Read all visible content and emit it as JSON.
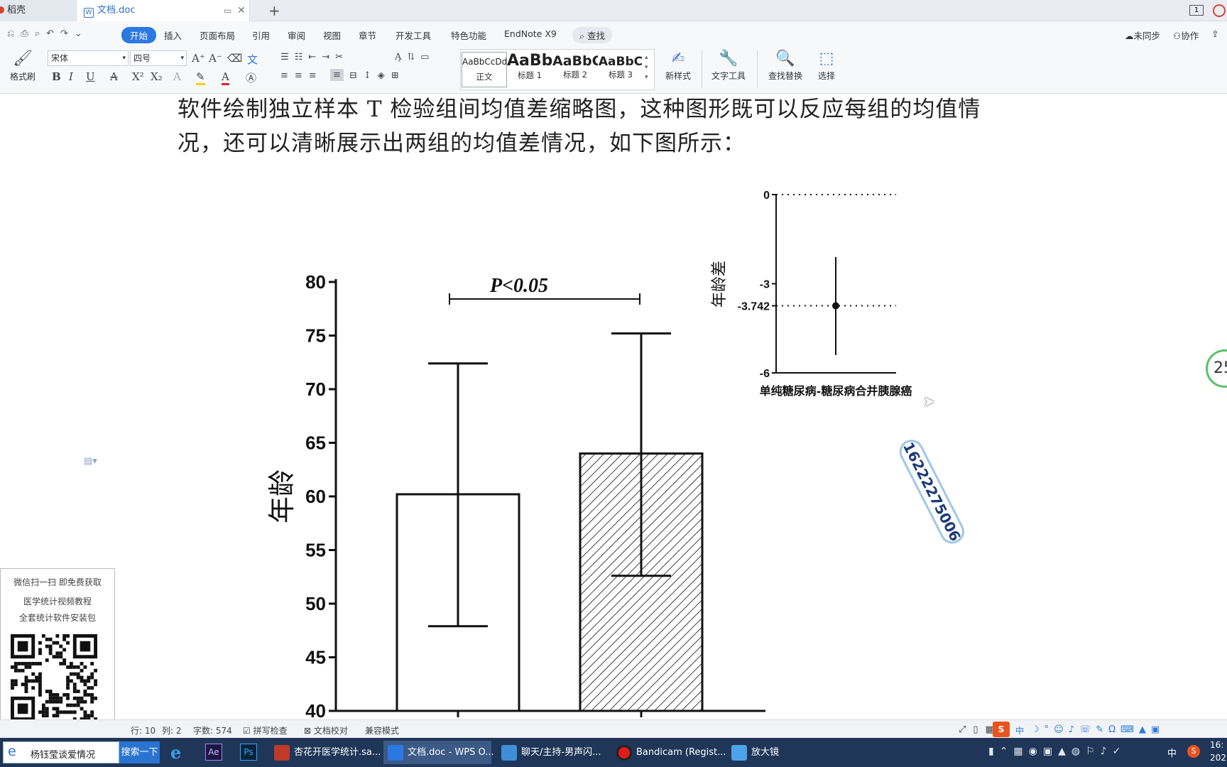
{
  "tabs": {
    "home": "稻壳",
    "document": "文档.doc",
    "new_tab": "+"
  },
  "menu": {
    "items": [
      "开始",
      "插入",
      "页面布局",
      "引用",
      "审阅",
      "视图",
      "章节",
      "开发工具",
      "特色功能",
      "EndNote X9"
    ],
    "search": "查找",
    "sync": "未同步",
    "collab": "协作"
  },
  "ribbon": {
    "format_painter": "格式刷",
    "font_name": "宋体",
    "font_size": "四号",
    "styles": [
      {
        "sample": "AaBbCcDd",
        "label": "正文"
      },
      {
        "sample": "AaBb",
        "label": "标题 1"
      },
      {
        "sample": "AaBbC",
        "label": "标题 2"
      },
      {
        "sample": "AaBbC",
        "label": "标题 3"
      }
    ],
    "new_style": "新样式",
    "text_tools": "文字工具",
    "find_replace": "查找替换",
    "select": "选择"
  },
  "document": {
    "line1": "软件绘制独立样本 T 检验组间均值差缩略图，这种图形既可以反应每组的均值情",
    "line2": "况，还可以清晰展示出两组的均值差情况，如下图所示："
  },
  "chart_data": [
    {
      "type": "bar",
      "ylabel": "年龄",
      "xlabel": "",
      "ylim": [
        40,
        80
      ],
      "yticks": [
        40,
        45,
        50,
        55,
        60,
        65,
        70,
        75,
        80
      ],
      "categories": [
        "",
        ""
      ],
      "values": [
        60.2,
        64.0
      ],
      "error_low": [
        47.9,
        52.6
      ],
      "error_high": [
        72.4,
        75.2
      ],
      "fills": [
        "white",
        "hatched"
      ],
      "annotation": "P<0.05",
      "grid": false
    },
    {
      "type": "scatter",
      "ylabel": "年龄差",
      "xlabel": "单纯糖尿病-糖尿病合并胰腺癌",
      "ylim": [
        -6,
        0
      ],
      "yticks": [
        "0",
        "-3",
        "-3.742",
        "-6"
      ],
      "point": -3.742,
      "error_low": -5.4,
      "error_high": -2.1,
      "grid": false
    }
  ],
  "watermark_phone": "16222275006",
  "promo": {
    "line1": "微信扫一扫 即免费获取",
    "line2": "医学统计视频教程",
    "line3": "全套统计软件安装包",
    "qr_text": "医学统计"
  },
  "status": {
    "row": "行: 10",
    "col": "列: 2",
    "words": "字数: 574",
    "spell": "拼写检查",
    "proof": "文档校对",
    "compat": "兼容模式"
  },
  "taskbar": {
    "search_text": "杨钰莹谈爱情况",
    "search_button": "搜索一下",
    "apps": [
      "杏花开医学统计.sa...",
      "文档.doc - WPS O...",
      "聊天/主持-男声闪...",
      "Bandicam (Regist...",
      "放大镜"
    ],
    "tray_lang": "中",
    "clock": "16:",
    "date": "202"
  },
  "colors": {
    "accent": "#2b79e0",
    "taskbar": "#1f3658"
  }
}
